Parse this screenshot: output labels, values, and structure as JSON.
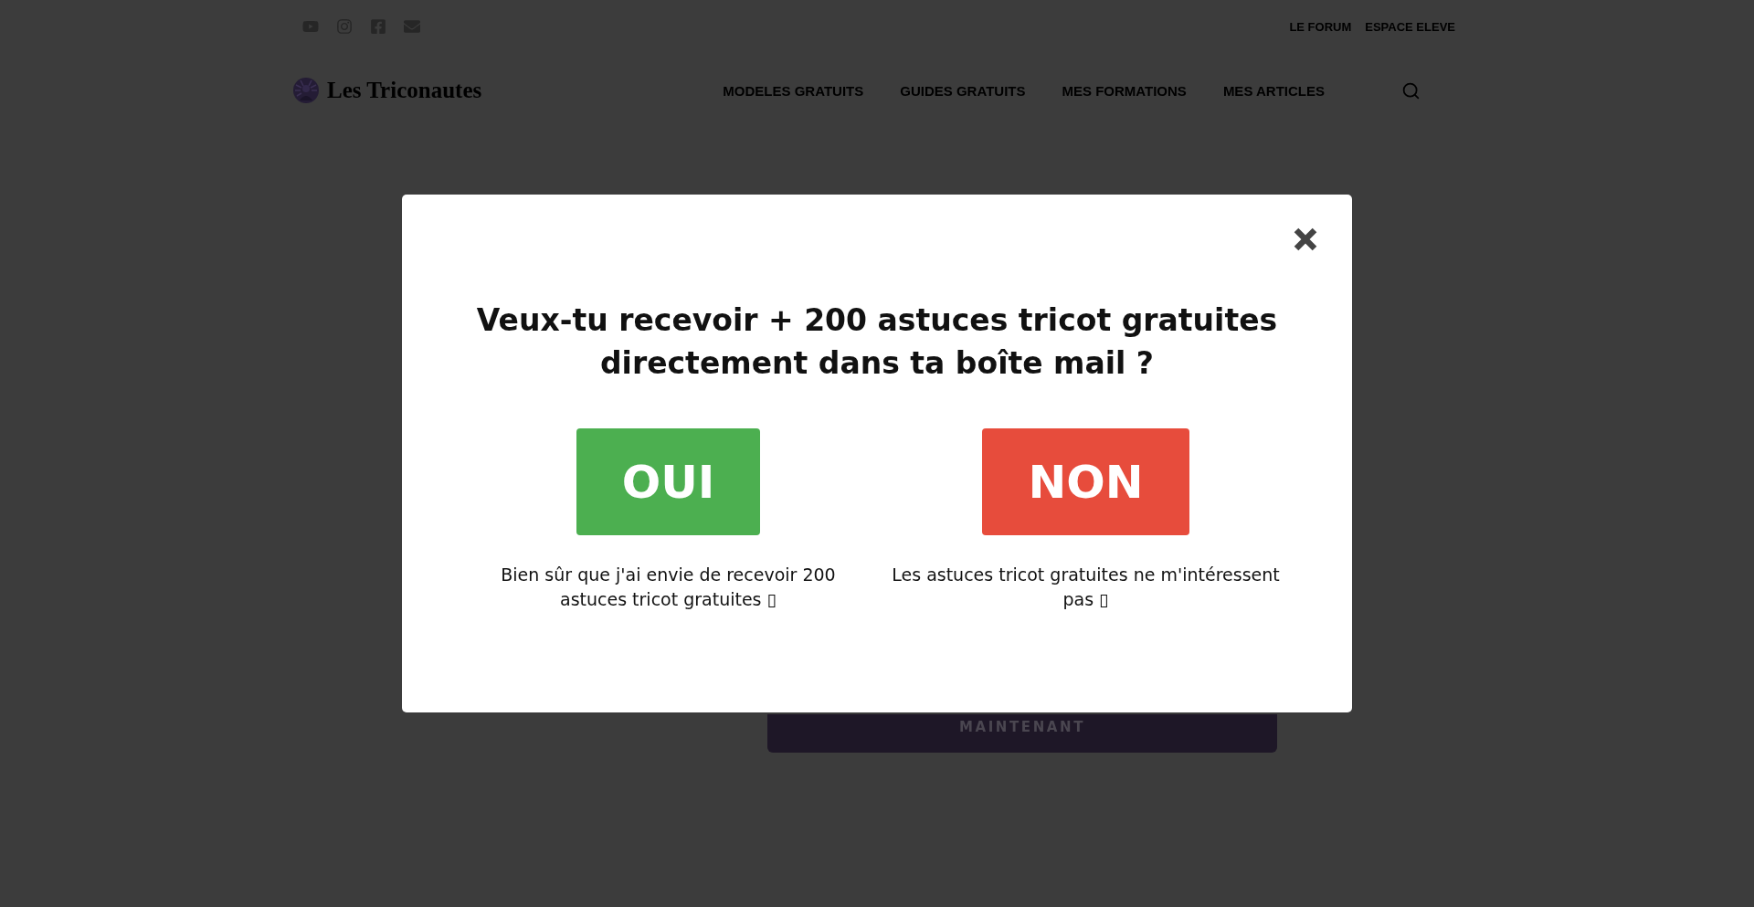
{
  "header": {
    "social_links": [
      {
        "kind": "youtube"
      },
      {
        "kind": "instagram"
      },
      {
        "kind": "facebook"
      },
      {
        "kind": "email"
      }
    ],
    "top_links": [
      "LE FORUM",
      "ESPACE ELEVE"
    ],
    "logo": {
      "text": "Les Triconautes"
    },
    "nav": [
      "MODELES GRATUITS",
      "GUIDES GRATUITS",
      "MES FORMATIONS",
      "MES ARTICLES"
    ]
  },
  "page": {
    "cta_button": "MAINTENANT"
  },
  "modal": {
    "title": "Veux-tu recevoir + 200 astuces tricot gratuites directement dans ta boîte mail ?",
    "choices": [
      {
        "kind": "accept",
        "label": "OUI",
        "description": "Bien sûr que j'ai envie de recevoir 200 astuces tricot gratuites ▯"
      },
      {
        "kind": "decline",
        "label": "NON",
        "description": "Les astuces tricot gratuites ne m'intéressent pas ▯"
      }
    ]
  }
}
